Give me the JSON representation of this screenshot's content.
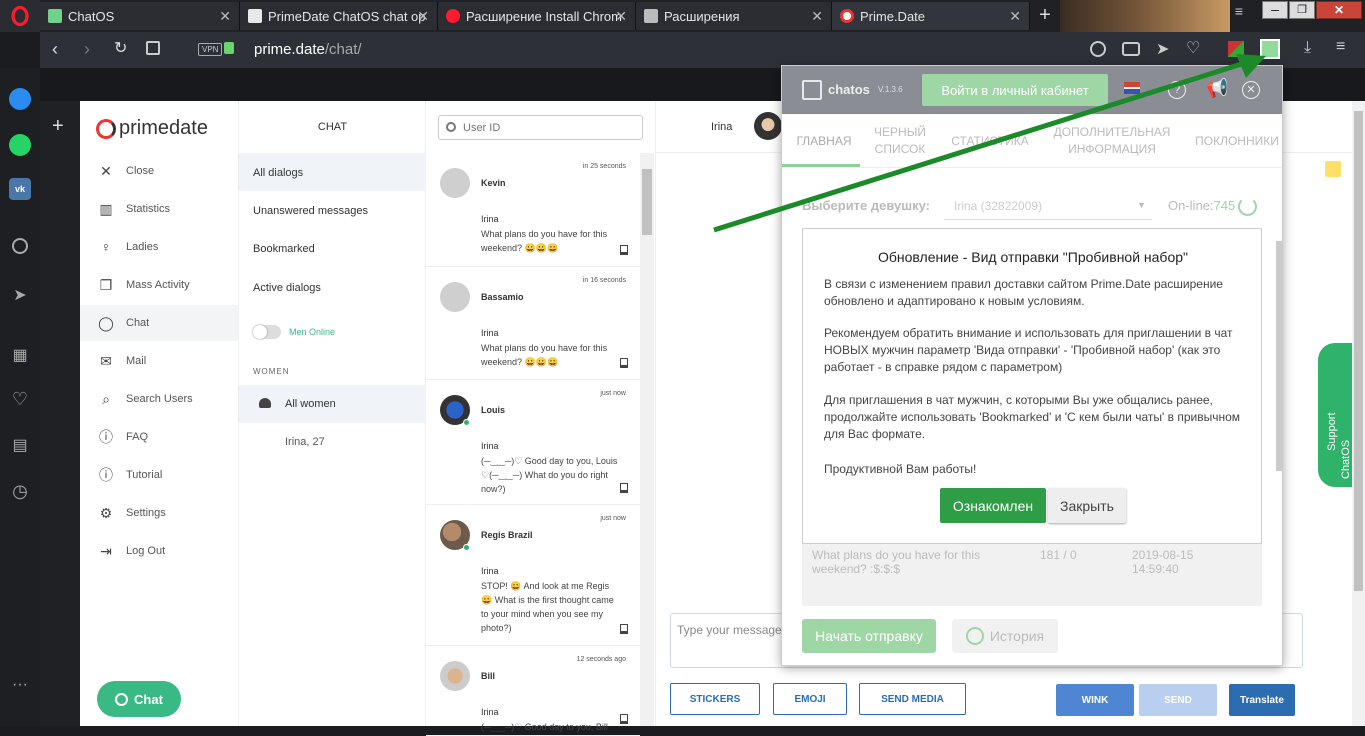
{
  "browser": {
    "tabs": [
      {
        "label": "ChatOS"
      },
      {
        "label": "PrimeDate ChatOS chat op"
      },
      {
        "label": "Расширение Install Chrom"
      },
      {
        "label": "Расширения"
      },
      {
        "label": "Prime.Date"
      }
    ],
    "url": {
      "host": "prime.date",
      "path": "/chat/"
    },
    "vpn": "VPN"
  },
  "app": {
    "logo": "primedate",
    "nav": [
      {
        "label": "Close",
        "icon": "close-icon"
      },
      {
        "label": "Statistics",
        "icon": "bar-chart-icon"
      },
      {
        "label": "Ladies",
        "icon": "ladies-icon"
      },
      {
        "label": "Mass Activity",
        "icon": "copy-icon"
      },
      {
        "label": "Chat",
        "icon": "chat-icon"
      },
      {
        "label": "Mail",
        "icon": "mail-icon"
      },
      {
        "label": "Search Users",
        "icon": "search-icon"
      },
      {
        "label": "FAQ",
        "icon": "info-icon"
      },
      {
        "label": "Tutorial",
        "icon": "info-icon"
      },
      {
        "label": "Settings",
        "icon": "gear-icon"
      },
      {
        "label": "Log Out",
        "icon": "logout-icon"
      }
    ],
    "chat_float_button": "Chat"
  },
  "dialogs": {
    "title": "CHAT",
    "items": [
      "All dialogs",
      "Unanswered messages",
      "Bookmarked",
      "Active dialogs"
    ],
    "men_online": "Men Online",
    "women_header": "WOMEN",
    "all_women": "All women",
    "woman": "Irina, 27"
  },
  "search": {
    "placeholder": "User ID"
  },
  "conversations": [
    {
      "time": "in 25 seconds",
      "name": "Kevin",
      "from": "Irina",
      "text": "What plans do you have for this weekend? 😀😀😀"
    },
    {
      "time": "in 16 seconds",
      "name": "Bassamio",
      "from": "Irina",
      "text": "What plans do you have for this weekend? 😀😀😀"
    },
    {
      "time": "just now",
      "name": "Louis",
      "from": "Irina",
      "text": "(─‿‿─)♡ Good day to you, Louis ♡(─‿‿─) What do you do right now?)"
    },
    {
      "time": "just now",
      "name": "Regis Brazil",
      "from": "Irina",
      "text": "STOP! 😀 And look at me Regis 😀 What is the first thought came to your mind when you see my photo?)"
    },
    {
      "time": "12 seconds ago",
      "name": "Bill",
      "from": "Irina",
      "text": "(─‿‿─)♡ Good day to you, Bill"
    }
  ],
  "main": {
    "header_name": "Irina",
    "composer_placeholder": "Type your message",
    "buttons": {
      "stickers": "STICKERS",
      "emoji": "EMOJI",
      "send_media": "SEND MEDIA",
      "wink": "WINK",
      "send": "SEND",
      "translate": "Translate"
    },
    "support_tab": {
      "support": "Support",
      "chatos": "ChatOS"
    }
  },
  "extension": {
    "logo": "chatos",
    "version": "V.1.3.6",
    "login_button": "Войти в личный кабинет",
    "tabs": [
      "ГЛАВНАЯ",
      "ЧЕРНЫЙ СПИСОК",
      "СТАТИСТИКА",
      "ДОПОЛНИТЕЛЬНАЯ ИНФОРМАЦИЯ",
      "ПОКЛОННИКИ"
    ],
    "select_label": "Выберите девушку:",
    "select_value": "Irina (32822009)",
    "online_label": "On-line:",
    "online_count": "745",
    "modal": {
      "title": "Обновление - Вид отправки \"Пробивной набор\"",
      "p1": "В связи с изменением правил доставки сайтом Prime.Date расширение обновлено и адаптировано к новым условиям.",
      "p2": "Рекомендуем обратить внимание и использовать для приглашении в чат НОВЫХ мужчин параметр 'Вида отправки' - 'Пробивной набор' (как это работает - в справке рядом с параметром)",
      "p3": "Для приглашения в чат мужчин, с которыми Вы уже общались ранее, продолжайте использовать 'Bookmarked' и 'С кем были чаты' в привычном для Вас формате.",
      "p4": "Продуктивной Вам работы!",
      "ok": "Ознакомлен",
      "close": "Закрыть"
    },
    "row": {
      "text": "What plans do you have for this weekend? :$:$:$",
      "count": "181 / 0",
      "date": "2019-08-15 14:59:40"
    },
    "start_button": "Начать отправку",
    "history_button": "История"
  },
  "colors": {
    "accent_green": "#2e9d45",
    "nav_teal": "#39b983",
    "arrow": "#1d8a2a",
    "translate": "#2b6db0"
  }
}
